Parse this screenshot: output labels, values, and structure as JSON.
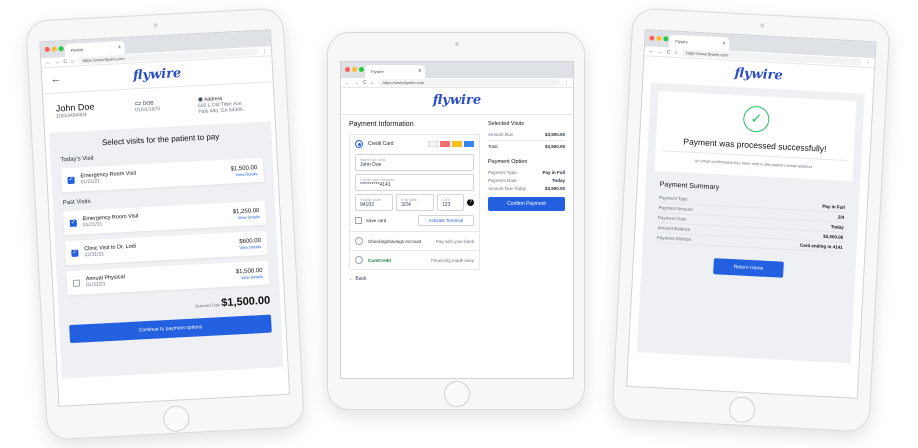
{
  "browser": {
    "tab_title": "Flywire",
    "tab_close": "x",
    "url": "https://www.flywire.com",
    "nav_icons": [
      "←",
      "→",
      "C",
      "⌂"
    ],
    "menu": "⋮"
  },
  "brand": {
    "logo": "flywire",
    "accent": "#2360e0"
  },
  "left": {
    "back": "←",
    "patient": {
      "name": "John Doe",
      "id": "10014454404",
      "dob_label": "DOB",
      "dob": "01/01/1970",
      "address_label": "Address",
      "address_line1": "600 L Old Tiber Ave",
      "address_line2": "Palo Alto, CA 94306"
    },
    "heading": "Select visits for the patient to pay",
    "today_label": "Today's Visit",
    "today_visits": [
      {
        "title": "Emergency Room Visit",
        "date": "01/21/21",
        "amount": "$1,500.00",
        "link": "View Details",
        "checked": true
      }
    ],
    "past_label": "Past Visits",
    "past_visits": [
      {
        "title": "Emergency Room Visit",
        "date": "01/21/21",
        "amount": "$1,250.00",
        "link": "View Details",
        "checked": true
      },
      {
        "title": "Clinic Visit to Dr. Lodi",
        "date": "12/31/21",
        "amount": "$600.00",
        "link": "View Details",
        "checked": true
      },
      {
        "title": "Annual Physical",
        "date": "01/31/21",
        "amount": "$1,500.00",
        "link": "View Details",
        "checked": false
      }
    ],
    "selected_label": "Selected Total",
    "selected_total": "$1,500.00",
    "continue_button": "Continue to payment options"
  },
  "middle": {
    "payment_title": "Payment Information",
    "credit_card_label": "Credit Card",
    "name_label": "Name on card",
    "name_value": "John Doe",
    "card_label": "Credit card number",
    "card_value": "**********4141",
    "postal_label": "Postal code",
    "postal_value": "94103",
    "exp_label": "Exp date",
    "exp_value": "3/24",
    "cvv_label": "CVV",
    "cvv_value": "123",
    "save_card": "Save card",
    "activate_terminal": "Activate Terminal",
    "checking_label": "Checking/Savings Account",
    "checking_hint": "Pay with your bank",
    "carecredit_label": "CareCredit",
    "carecredit_hint": "Financing made easy",
    "back": "← Back",
    "selected_visits": "Selected Visits",
    "amount_due_label": "Amount Due",
    "amount_due": "$3,500.00",
    "total_label": "Total",
    "total": "$3,500.00",
    "payment_option": "Payment Option",
    "type_label": "Payment Type",
    "type_value": "Pay in Full",
    "date_label": "Payment Date",
    "date_value": "Today",
    "due_today_label": "Amount Due Today",
    "due_today": "$3,500.00",
    "confirm_button": "Confirm Payment"
  },
  "right": {
    "success_title": "Payment was processed successfully!",
    "success_sub": "An email confirmation has been sent to the patient's email address.",
    "summary_title": "Payment Summary",
    "rows": [
      {
        "label": "Payment Type",
        "value": "Pay in Full"
      },
      {
        "label": "Payment Amount",
        "value": "2/4"
      },
      {
        "label": "Payment Date",
        "value": "Today"
      },
      {
        "label": "Amount Balance",
        "value": "$3,500.00"
      },
      {
        "label": "Payment Method",
        "value": "Card ending in 4141"
      }
    ],
    "return_button": "Return Home"
  }
}
